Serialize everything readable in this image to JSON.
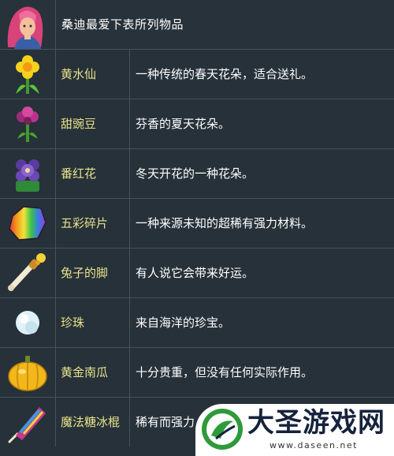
{
  "header": {
    "title": "桑迪最爱下表所列物品",
    "portrait_icon": "sandy-portrait-icon"
  },
  "rows": [
    {
      "name": "黄水仙",
      "desc": "一种传统的春天花朵，适合送礼。",
      "icon": "daffodil-icon"
    },
    {
      "name": "甜豌豆",
      "desc": "芬香的夏天花朵。",
      "icon": "sweet-pea-icon"
    },
    {
      "name": "番红花",
      "desc": "冬天开花的一种花朵。",
      "icon": "crocus-icon"
    },
    {
      "name": "五彩碎片",
      "desc": "一种来源未知的超稀有强力材料。",
      "icon": "prismatic-shard-icon"
    },
    {
      "name": "兔子的脚",
      "desc": "有人说它会带来好运。",
      "icon": "rabbit-foot-icon"
    },
    {
      "name": "珍珠",
      "desc": "来自海洋的珍宝。",
      "icon": "pearl-icon"
    },
    {
      "name": "黄金南瓜",
      "desc": "十分贵重，但没有任何实际作用。",
      "icon": "golden-pumpkin-icon"
    },
    {
      "name": "魔法糖冰棍",
      "desc": "稀有而强力",
      "icon": "magic-rock-candy-icon"
    }
  ],
  "watermark": {
    "brand": "大圣游戏网",
    "url": "www.daseen.net"
  },
  "colors": {
    "background": "#263139",
    "border": "#46535c",
    "name_text": "#e8e28a",
    "desc_text": "#ffffff"
  }
}
